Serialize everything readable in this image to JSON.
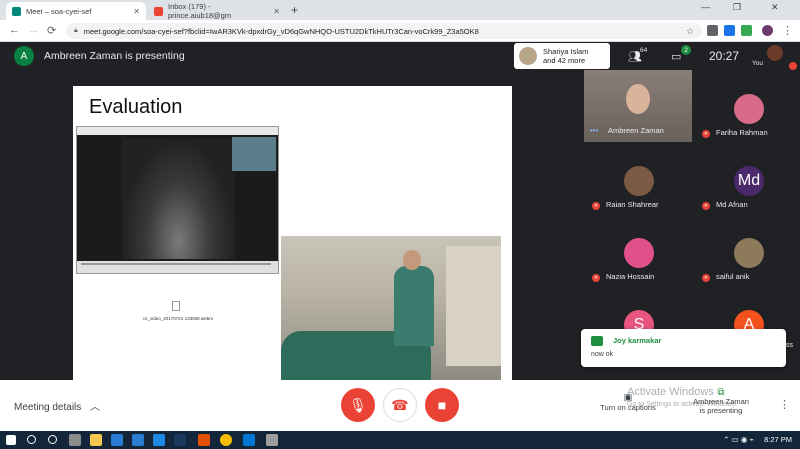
{
  "browser": {
    "tabs": [
      {
        "title": "Meet – soa-cyei-sef",
        "favicon_color": "#00897b"
      },
      {
        "title": "Inbox (179) - prince.aiub18@gm",
        "favicon_color": "#ea4335"
      }
    ],
    "url": "meet.google.com/soa-cyei-sef?fbclid=IwAR3KVk-dpxdrGy_vD6qGwNHQO-USTU2DkTkHUTr3Can-voCrk99_Z3a5OK8"
  },
  "meet": {
    "presenter_initial": "A",
    "presenting_text": "Ambreen Zaman is presenting",
    "others_line1": "Shariya Islam",
    "others_line2": "and 42 more",
    "participants_count": "64",
    "chat_count": "2",
    "time": "20:27",
    "you_label": "You",
    "slide": {
      "title": "Evaluation",
      "filename": "cs_video_20170721-133936.webm"
    },
    "participants": [
      {
        "name": "Ambreen Zaman",
        "initial": "",
        "color": "#6a615b"
      },
      {
        "name": "Fariha Rahman",
        "initial": "",
        "color": "#d86b8a"
      },
      {
        "name": "Raian Shahrear",
        "initial": "",
        "color": "#7c5a43"
      },
      {
        "name": "Md Afnan",
        "initial": "Md",
        "color": "#4a2a6b"
      },
      {
        "name": "Nazia Hossain",
        "initial": "",
        "color": "#e0508a"
      },
      {
        "name": "saiful anik",
        "initial": "",
        "color": "#8c7a5a"
      },
      {
        "name": "",
        "initial": "S",
        "color": "#e8557e"
      },
      {
        "name": "",
        "initial": "A",
        "color": "#f4511e"
      }
    ],
    "chat_toast": {
      "sender": "Joy karmakar",
      "message": "now ok"
    },
    "bottom": {
      "meeting_details": "Meeting details",
      "captions": "Turn on captions",
      "present_line1": "Ambreen Zaman",
      "present_line2": "is presenting",
      "watermark_title": "Activate Windows",
      "watermark_sub": "Go to Settings to activate Windows."
    }
  },
  "taskbar": {
    "time": "8:27 PM"
  }
}
